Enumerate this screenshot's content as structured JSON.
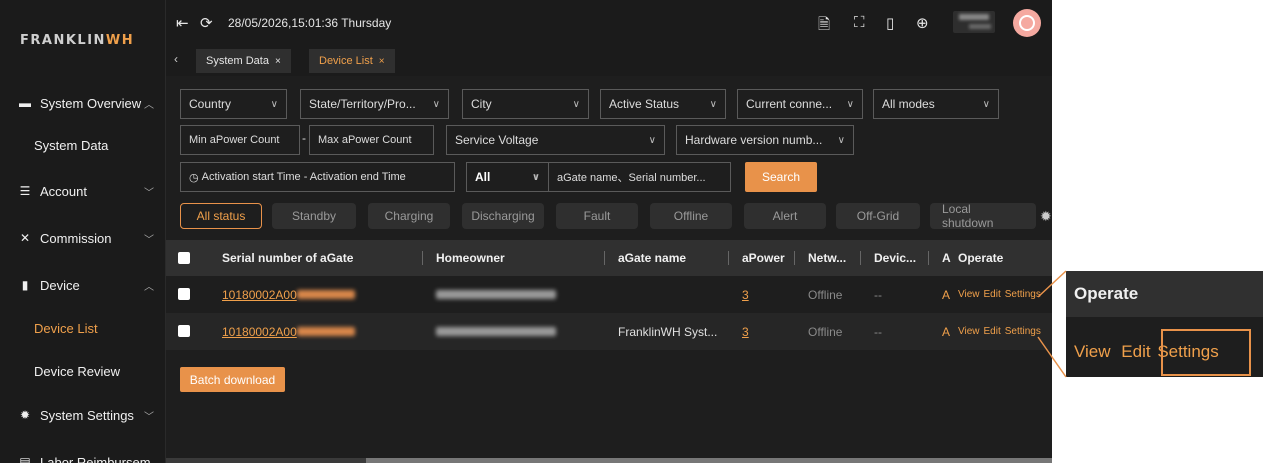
{
  "brand": {
    "logo_main": "FRANKLIN",
    "logo_accent": "WH"
  },
  "topbar": {
    "datetime": "28/05/2026,15:01:36 Thursday"
  },
  "tabs": [
    {
      "label": "System Data",
      "active": false
    },
    {
      "label": "Device List",
      "active": true
    }
  ],
  "sidebar": {
    "items": [
      {
        "label": "System Overview",
        "icon": "monitor-icon",
        "chevron": "^"
      },
      {
        "label": "System Data",
        "sub": true
      },
      {
        "label": "Account",
        "icon": "account-icon",
        "chevron": "v"
      },
      {
        "label": "Commission",
        "icon": "tools-icon",
        "chevron": "v"
      },
      {
        "label": "Device",
        "icon": "device-icon",
        "chevron": "^"
      },
      {
        "label": "Device List",
        "sub": true,
        "active": true
      },
      {
        "label": "Device Review",
        "sub": true
      },
      {
        "label": "System Settings",
        "icon": "gear-icon",
        "chevron": "v"
      },
      {
        "label": "Labor Reimbursem",
        "icon": "wallet-icon"
      }
    ]
  },
  "filters": {
    "country": "Country",
    "state": "State/Territory/Pro...",
    "city": "City",
    "active_status": "Active Status",
    "current_connection": "Current conne...",
    "mode": "All modes",
    "min_apower": "Min aPower Count",
    "max_apower": "Max aPower Count",
    "dash": "-",
    "service_voltage": "Service Voltage",
    "hardware_version": "Hardware version numb...",
    "activation_range": "Activation start Time  -  Activation end Time",
    "search_scope": "All",
    "search_placeholder": "aGate name、Serial number...",
    "search_button": "Search"
  },
  "status_filters": [
    "All status",
    "Standby",
    "Charging",
    "Discharging",
    "Fault",
    "Offline",
    "Alert",
    "Off-Grid",
    "Local shutdown"
  ],
  "table": {
    "headers": [
      "Serial number of aGate",
      "Homeowner",
      "aGate name",
      "aPower",
      "Netw...",
      "Devic...",
      "A",
      "Operate"
    ],
    "rows": [
      {
        "serial": "10180002A00",
        "agate_name": "",
        "apower": "3",
        "network": "Offline",
        "device": "--",
        "a": "A"
      },
      {
        "serial": "10180002A00",
        "agate_name": "FranklinWH Syst...",
        "apower": "3",
        "network": "Offline",
        "device": "--",
        "a": "A"
      }
    ],
    "operate": {
      "view": "View",
      "edit": "Edit",
      "settings": "Settings"
    }
  },
  "batch_download": "Batch download",
  "zoom": {
    "header": "Operate",
    "view": "View",
    "edit": "Edit",
    "settings": "Settings"
  },
  "colors": {
    "accent": "#e8924a",
    "background": "#1e1e1e",
    "header": "#303030"
  }
}
